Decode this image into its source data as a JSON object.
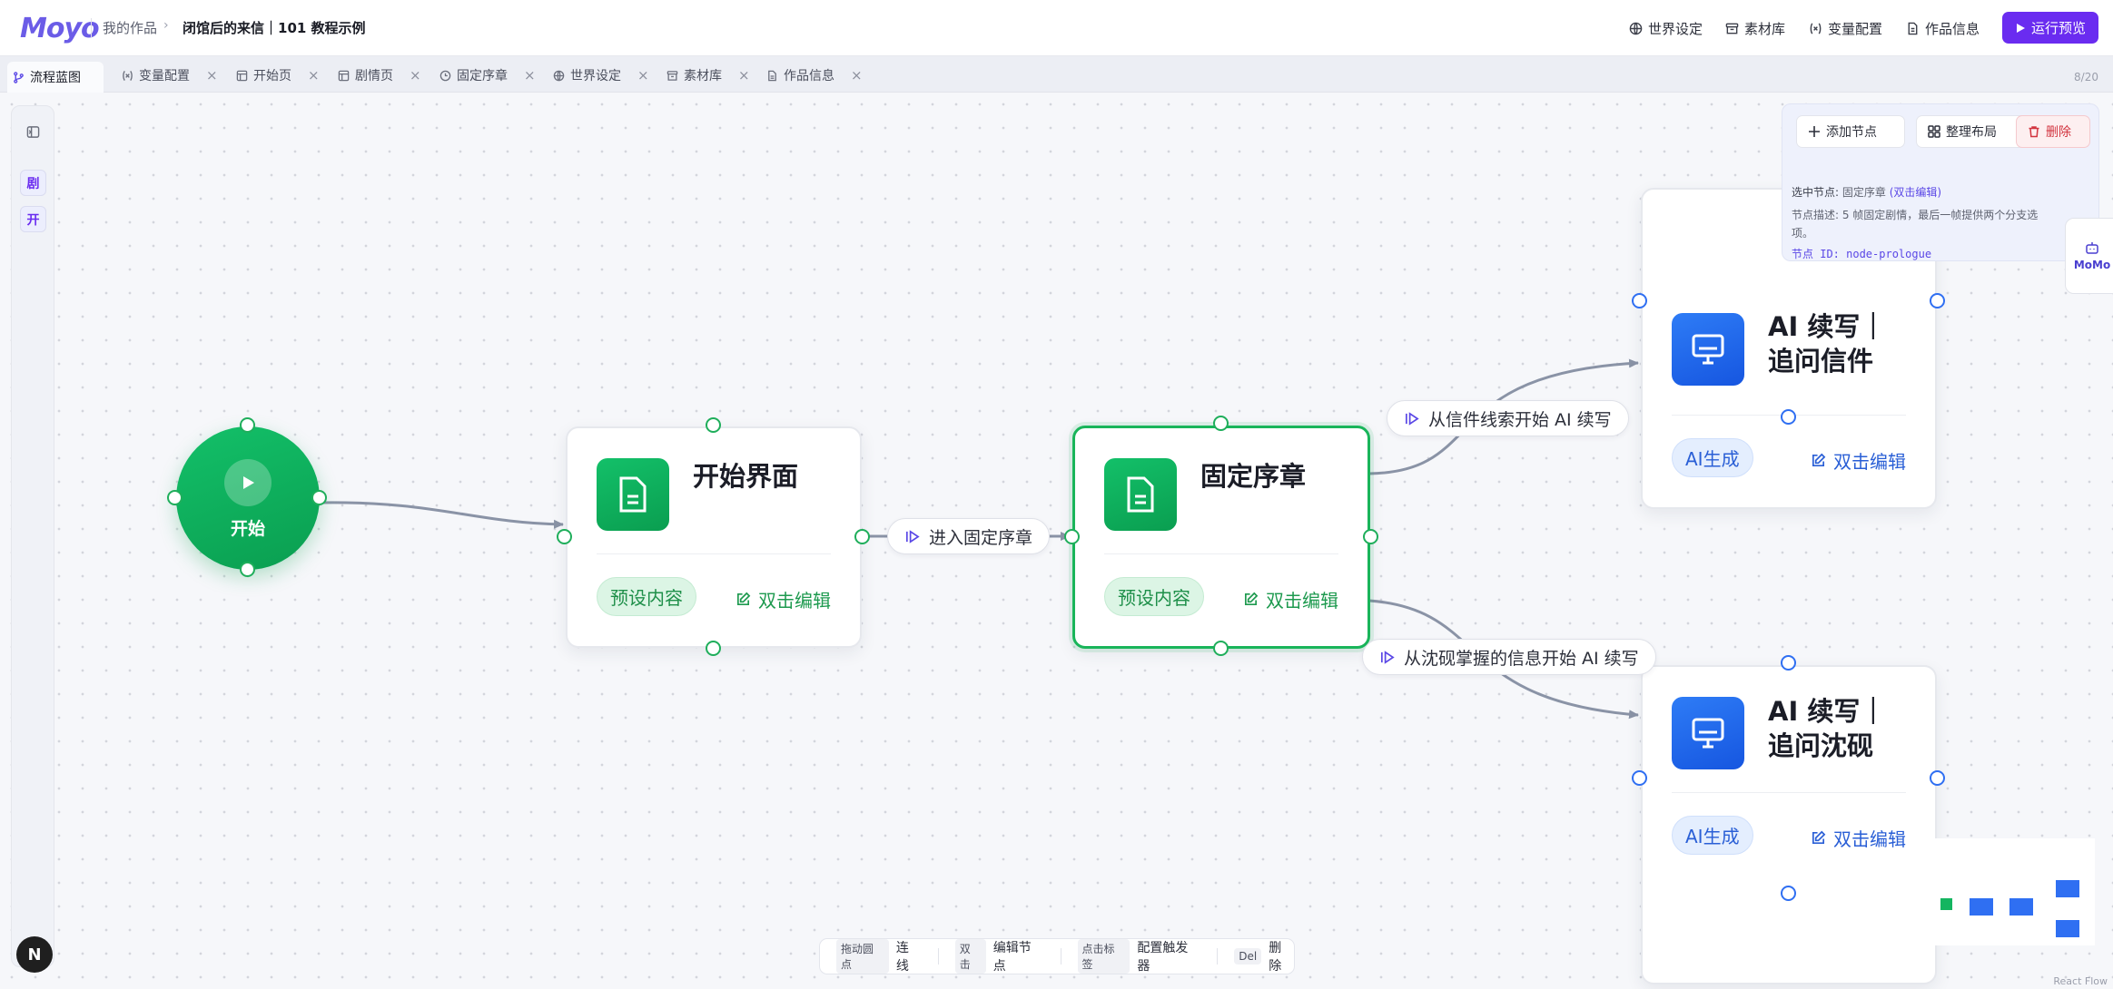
{
  "header": {
    "logo": "Moyo",
    "breadcrumb_root": "我的作品",
    "breadcrumb_current": "闭馆后的来信｜101 教程示例",
    "links": [
      "世界设定",
      "素材库",
      "变量配置",
      "作品信息"
    ],
    "run_label": "运行预览"
  },
  "tabs": {
    "items": [
      {
        "label": "流程蓝图",
        "icon": "branch-icon"
      },
      {
        "label": "变量配置",
        "icon": "variable-icon"
      },
      {
        "label": "开始页",
        "icon": "layout-icon"
      },
      {
        "label": "剧情页",
        "icon": "layout-icon"
      },
      {
        "label": "固定序章",
        "icon": "clock-icon"
      },
      {
        "label": "世界设定",
        "icon": "globe-icon"
      },
      {
        "label": "素材库",
        "icon": "archive-icon"
      },
      {
        "label": "作品信息",
        "icon": "file-icon"
      }
    ],
    "close_glyph": "×",
    "count": "8/20"
  },
  "rail": {
    "btn_1": "剧",
    "btn_2": "开"
  },
  "nodes": {
    "start": {
      "label": "开始"
    },
    "start_page": {
      "title": "开始界面",
      "pill": "预设内容",
      "edit": "双击编辑"
    },
    "prologue": {
      "title": "固定序章",
      "pill": "预设内容",
      "edit": "双击编辑"
    },
    "ai_letter": {
      "title_line1": "AI 续写｜",
      "title_line2": "追问信件",
      "pill": "AI生成",
      "edit": "双击编辑"
    },
    "ai_yan": {
      "title_line1": "AI 续写｜",
      "title_line2": "追问沈砚",
      "pill": "AI生成",
      "edit": "双击编辑"
    }
  },
  "edges": {
    "to_prologue": "进入固定序章",
    "to_letter": "从信件线索开始 AI 续写",
    "to_yan": "从沈砚掌握的信息开始 AI 续写"
  },
  "panel": {
    "add_node": "添加节点",
    "arrange": "整理布局",
    "delete": "删除",
    "selected_prefix": "选中节点:",
    "selected_name": "固定序章",
    "selected_hint": "(双击编辑)",
    "desc": "节点描述: 5 帧固定剧情，最后一帧提供两个分支选项。",
    "id": "节点 ID: node-prologue"
  },
  "momo": "MoMo",
  "hints": [
    {
      "key": "拖动圆点",
      "text": "连线"
    },
    {
      "key": "双击",
      "text": "编辑节点"
    },
    {
      "key": "点击标签",
      "text": "配置触发器"
    },
    {
      "key": "Del",
      "text": "删除"
    }
  ],
  "attribution": "React Flow",
  "colors": {
    "accent": "#6a2cf0",
    "node_green": "#13b560",
    "node_blue": "#2563eb",
    "danger": "#d2343f"
  }
}
